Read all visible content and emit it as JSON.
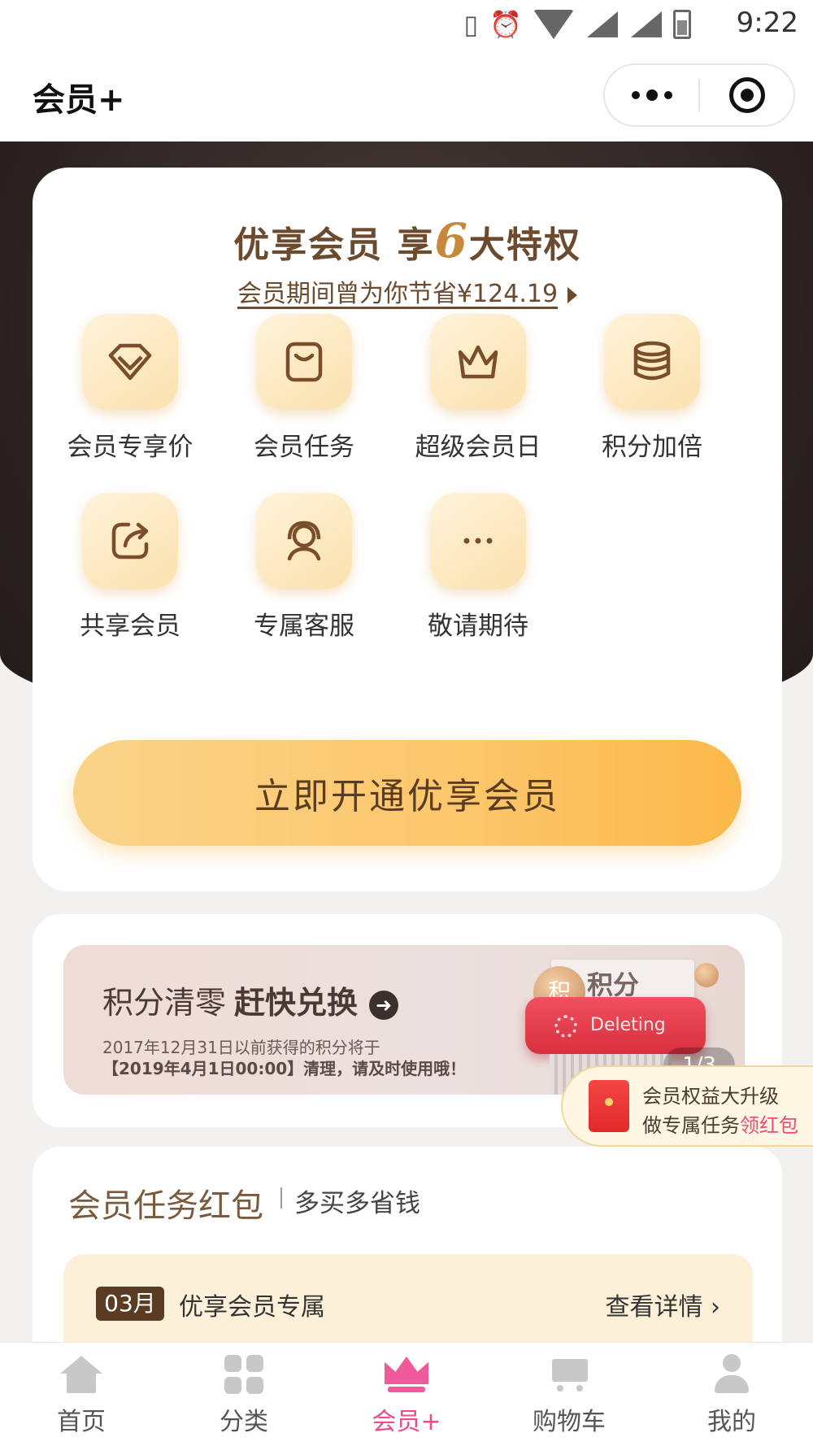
{
  "status_bar": {
    "time": "9:22"
  },
  "nav": {
    "title": "会员+"
  },
  "privilege": {
    "title_prefix": "优享会员 享",
    "title_num": "6",
    "title_suffix": "大特权",
    "saved_text": "会员期间曾为你节省¥124.19",
    "items": [
      {
        "label": "会员专享价",
        "icon": "diamond-icon"
      },
      {
        "label": "会员任务",
        "icon": "bag-icon"
      },
      {
        "label": "超级会员日",
        "icon": "crown-icon"
      },
      {
        "label": "积分加倍",
        "icon": "coins-stack-icon"
      },
      {
        "label": "共享会员",
        "icon": "share-icon"
      },
      {
        "label": "专属客服",
        "icon": "customer-service-icon"
      },
      {
        "label": "敬请期待",
        "icon": "more-dots-icon"
      }
    ],
    "cta_label": "立即开通优享会员"
  },
  "banner": {
    "heading": "积分清零",
    "heading_bold": "赶快兑换",
    "line1": "2017年12月31日以前获得的积分将于",
    "line2": "【2019年4月1日00:00】清理，请及时使用哦！",
    "paper_text": "积分",
    "coin_text": "积",
    "shredder_label": "Deleting",
    "pager": "1/3"
  },
  "promo": {
    "line1": "会员权益大升级",
    "line2_prefix": "做专属任务",
    "line2_highlight": "领红包"
  },
  "task": {
    "title": "会员任务红包",
    "subtitle": "多买多省钱",
    "month": "03月",
    "row_label": "优享会员专属",
    "row_link": "查看详情 ›"
  },
  "tabbar": {
    "items": [
      {
        "label": "首页",
        "icon": "home-icon"
      },
      {
        "label": "分类",
        "icon": "category-icon"
      },
      {
        "label": "会员+",
        "icon": "crown-icon",
        "active": true
      },
      {
        "label": "购物车",
        "icon": "cart-icon"
      },
      {
        "label": "我的",
        "icon": "user-icon"
      }
    ]
  },
  "colors": {
    "accent_pink": "#f04a8a",
    "gold_dark": "#6b4a2e",
    "cta_yellow": "#fcc66a",
    "header_dark": "#2b2220"
  }
}
